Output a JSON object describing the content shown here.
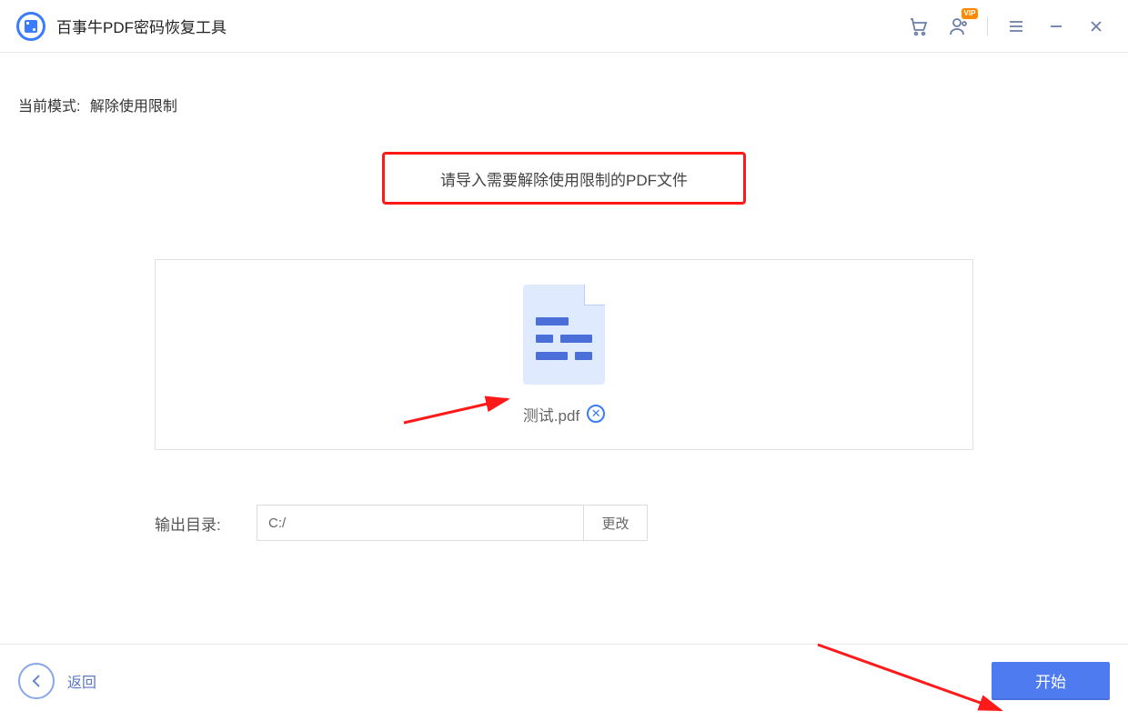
{
  "titlebar": {
    "app_title": "百事牛PDF密码恢复工具",
    "vip_badge": "VIP"
  },
  "content": {
    "mode_label": "当前模式:",
    "mode_value": "解除使用限制",
    "import_prompt": "请导入需要解除使用限制的PDF文件",
    "file_name": "测试.pdf",
    "remove_glyph": "✕",
    "output_label": "输出目录:",
    "output_path": "C:/",
    "change_label": "更改"
  },
  "footer": {
    "back_label": "返回",
    "start_label": "开始"
  }
}
